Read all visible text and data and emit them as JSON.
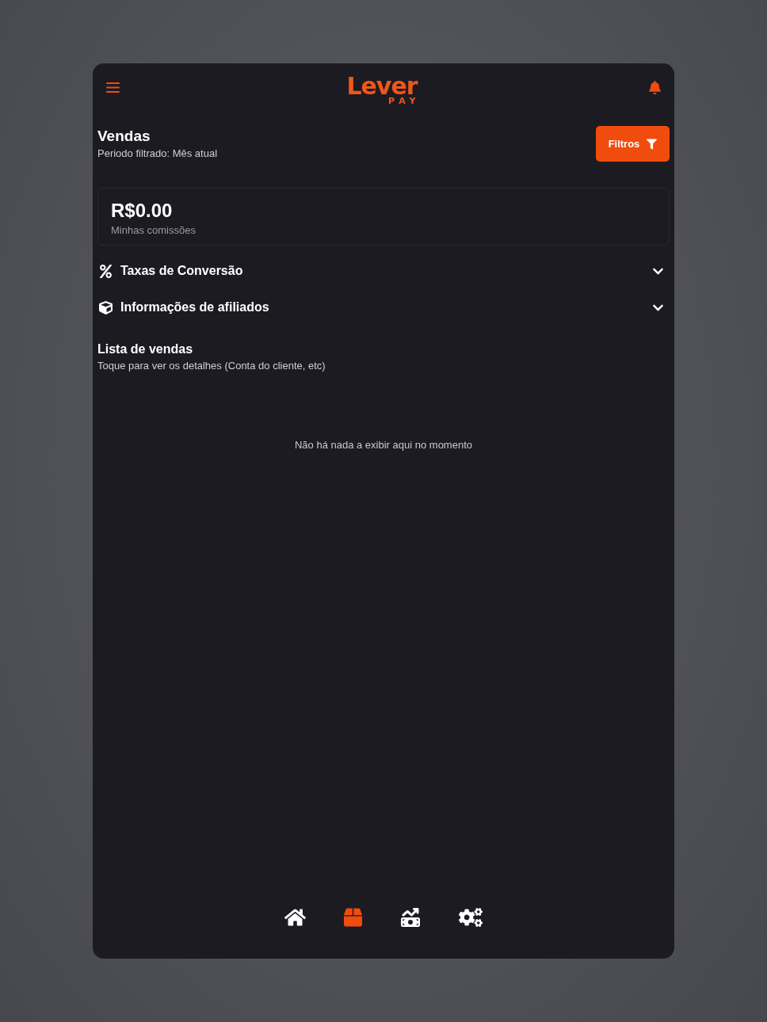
{
  "header": {
    "logo": {
      "wordmark": "Lever",
      "tagline": "PAY"
    }
  },
  "page": {
    "title": "Vendas",
    "subtitle": "Periodo filtrado: Mês atual",
    "filter_button": "Filtros"
  },
  "summary": {
    "amount": "R$0.00",
    "label": "Minhas comissões"
  },
  "sections": [
    {
      "kind": "percent",
      "title": "Taxas de Conversão",
      "expanded": false
    },
    {
      "kind": "cube",
      "title": "Informações de afiliados",
      "expanded": false
    }
  ],
  "sales_list": {
    "title": "Lista de vendas",
    "subtitle": "Toque para ver os detalhes (Conta do cliente, etc)",
    "empty_message": "Não há nada a exibir aqui no momento"
  },
  "bottom_nav": [
    {
      "kind": "home",
      "selected": false
    },
    {
      "kind": "box",
      "selected": true
    },
    {
      "kind": "money",
      "selected": false
    },
    {
      "kind": "gears",
      "selected": false
    }
  ]
}
